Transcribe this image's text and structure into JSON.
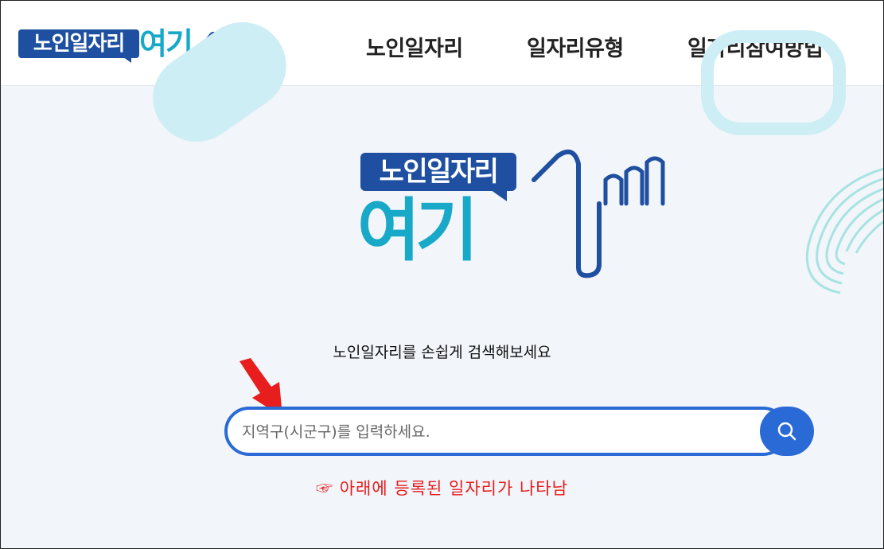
{
  "header": {
    "logo": {
      "badge_text": "노인일자리",
      "wordmark_text": "여기"
    },
    "nav": [
      {
        "label": "노인일자리"
      },
      {
        "label": "일자리유형"
      },
      {
        "label": "일자리참여방법"
      }
    ]
  },
  "hero": {
    "logo": {
      "badge_text": "노인일자리",
      "wordmark_text": "여기"
    },
    "tagline": "노인일자리를 손쉽게 검색해보세요"
  },
  "search": {
    "placeholder": "지역구(시군구)를 입력하세요.",
    "value": "",
    "button_icon": "search-icon"
  },
  "annotation": {
    "hint": "☞ 아래에 등록된 일자리가 나타남",
    "arrow_icon": "red-arrow-icon",
    "color": "#e81d1d"
  },
  "colors": {
    "brand_blue": "#1e4fa0",
    "brand_teal": "#19a9c8",
    "accent": "#2a6ad6"
  }
}
